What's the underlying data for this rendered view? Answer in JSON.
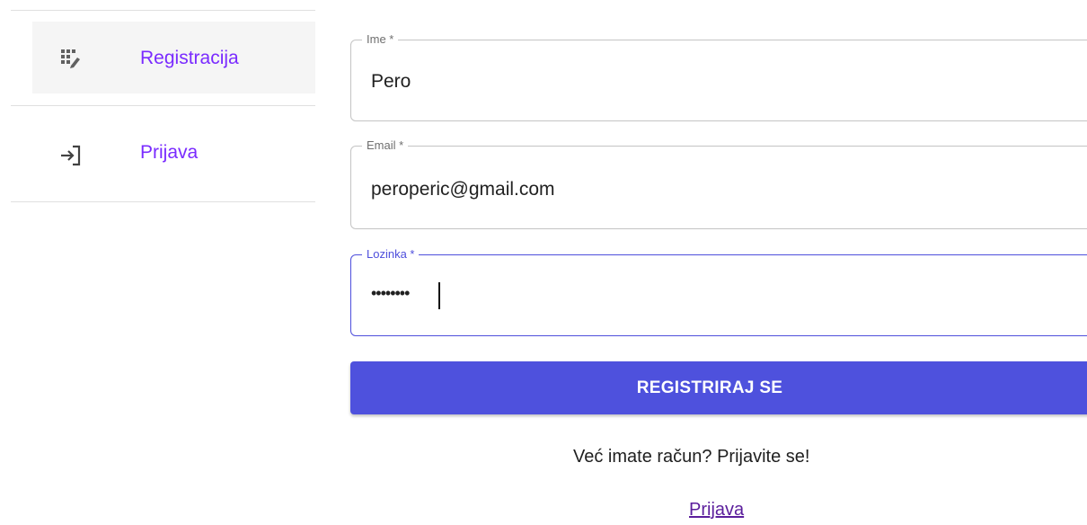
{
  "sidebar": {
    "items": [
      {
        "label": "Registracija",
        "icon": "dialpad-edit-icon",
        "active": true
      },
      {
        "label": "Prijava",
        "icon": "login-icon",
        "active": false
      }
    ]
  },
  "form": {
    "name": {
      "label": "Ime *",
      "value": "Pero"
    },
    "email": {
      "label": "Email *",
      "value": "peroperic@gmail.com"
    },
    "password": {
      "label": "Lozinka *",
      "value": "••••••••"
    },
    "submit_label": "REGISTRIRAJ SE",
    "prompt": "Već imate račun? Prijavite se!",
    "login_link": "Prijava"
  },
  "colors": {
    "accent": "#4e51dd",
    "nav_text": "#7a2bff",
    "link": "#5b1e9c"
  }
}
